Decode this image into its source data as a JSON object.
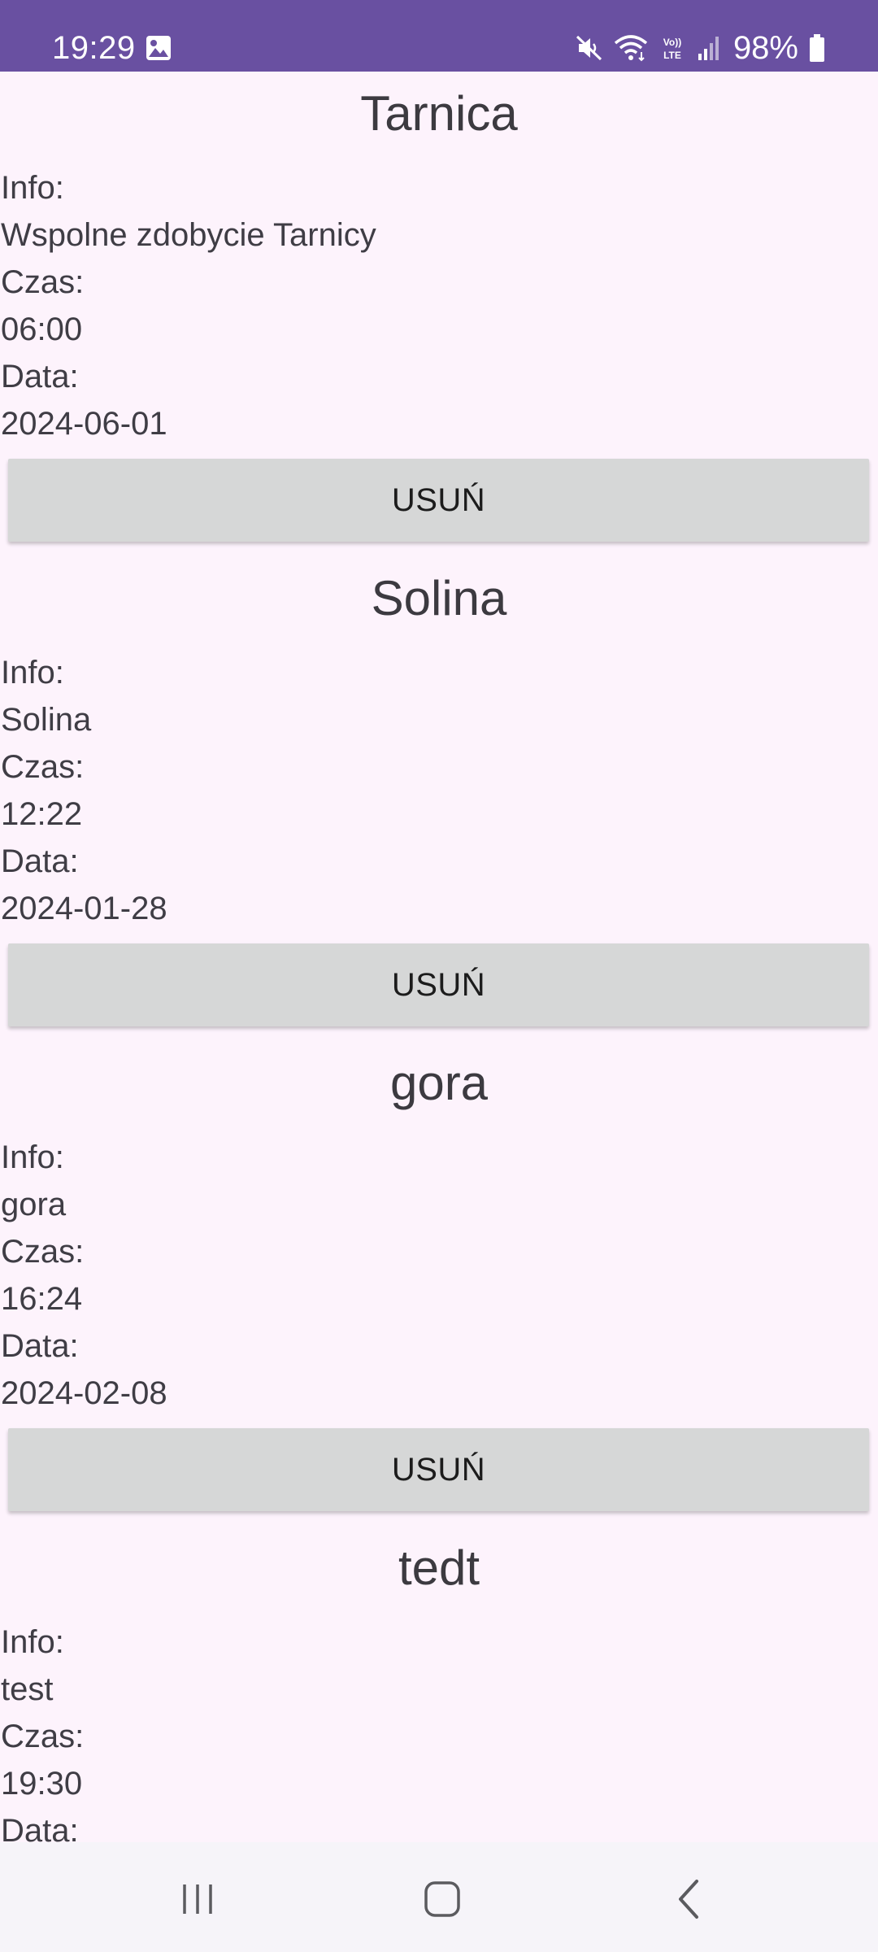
{
  "status_bar": {
    "time": "19:29",
    "battery": "98%",
    "icons": [
      "image-icon",
      "mute-icon",
      "wifi-icon",
      "volte-icon",
      "signal-icon",
      "battery-icon"
    ],
    "background_color": "#6950a1"
  },
  "events": [
    {
      "name": "Tarnica",
      "info_label": "Info:",
      "info": "Wspolne zdobycie Tarnicy",
      "time_label": "Czas:",
      "time": "06:00",
      "date_label": "Data:",
      "date": "2024-06-01",
      "delete_label": "USUŃ"
    },
    {
      "name": "Solina",
      "info_label": "Info:",
      "info": "Solina",
      "time_label": "Czas:",
      "time": "12:22",
      "date_label": "Data:",
      "date": "2024-01-28",
      "delete_label": "USUŃ"
    },
    {
      "name": "gora",
      "info_label": "Info:",
      "info": "gora",
      "time_label": "Czas:",
      "time": "16:24",
      "date_label": "Data:",
      "date": "2024-02-08",
      "delete_label": "USUŃ"
    },
    {
      "name": "tedt",
      "info_label": "Info:",
      "info": "test",
      "time_label": "Czas:",
      "time": "19:30",
      "date_label": "Data:"
    }
  ],
  "navigation_bar": {
    "buttons": [
      "recents-icon",
      "home-icon",
      "back-icon"
    ]
  },
  "colors": {
    "background": "#fdf3fc",
    "button": "#d6d7d7",
    "text": "#3f3d45"
  }
}
